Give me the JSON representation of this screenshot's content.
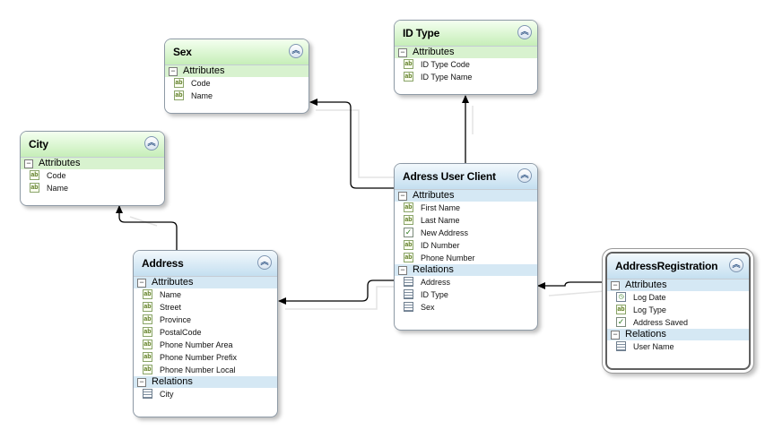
{
  "entities": {
    "sex": {
      "title": "Sex",
      "attributes_label": "Attributes",
      "attributes": [
        {
          "name": "Code",
          "icon": "ab-icon"
        },
        {
          "name": "Name",
          "icon": "ab-icon"
        }
      ]
    },
    "id_type": {
      "title": "ID Type",
      "attributes_label": "Attributes",
      "attributes": [
        {
          "name": "ID Type Code",
          "icon": "ab-icon"
        },
        {
          "name": "ID Type Name",
          "icon": "ab-icon"
        }
      ]
    },
    "city": {
      "title": "City",
      "attributes_label": "Attributes",
      "attributes": [
        {
          "name": "Code",
          "icon": "ab-icon"
        },
        {
          "name": "Name",
          "icon": "ab-icon"
        }
      ]
    },
    "adress_user_client": {
      "title": "Adress User Client",
      "attributes_label": "Attributes",
      "attributes": [
        {
          "name": "First Name",
          "icon": "ab-icon"
        },
        {
          "name": "Last Name",
          "icon": "ab-icon"
        },
        {
          "name": "New Address",
          "icon": "check-icon"
        },
        {
          "name": "ID Number",
          "icon": "ab-icon"
        },
        {
          "name": "Phone Number",
          "icon": "ab-icon"
        }
      ],
      "relations_label": "Relations",
      "relations": [
        {
          "name": "Address",
          "icon": "table-link-icon"
        },
        {
          "name": "ID Type",
          "icon": "table-icon"
        },
        {
          "name": "Sex",
          "icon": "table-icon"
        }
      ]
    },
    "address": {
      "title": "Address",
      "attributes_label": "Attributes",
      "attributes": [
        {
          "name": "Name",
          "icon": "ab-icon"
        },
        {
          "name": "Street",
          "icon": "ab-icon"
        },
        {
          "name": "Province",
          "icon": "ab-icon"
        },
        {
          "name": "PostalCode",
          "icon": "ab-icon"
        },
        {
          "name": "Phone Number Area",
          "icon": "ab-icon"
        },
        {
          "name": "Phone Number Prefix",
          "icon": "ab-icon"
        },
        {
          "name": "Phone Number Local",
          "icon": "ab-icon"
        }
      ],
      "relations_label": "Relations",
      "relations": [
        {
          "name": "City",
          "icon": "table-icon"
        }
      ]
    },
    "address_registration": {
      "title": "AddressRegistration",
      "attributes_label": "Attributes",
      "attributes": [
        {
          "name": "Log Date",
          "icon": "calendar-icon"
        },
        {
          "name": "Log Type",
          "icon": "ab-icon"
        },
        {
          "name": "Address Saved",
          "icon": "check-icon"
        }
      ],
      "relations_label": "Relations",
      "relations": [
        {
          "name": "User Name",
          "icon": "table-link-icon"
        }
      ]
    }
  },
  "icons": {
    "ab_text": "ab",
    "collapse_glyph": "︽",
    "toggle_glyph": "−",
    "check_glyph": "✓"
  },
  "colors": {
    "green_header": "#c6eeb8",
    "blue_header": "#c4dff0",
    "connector": "#000000"
  }
}
